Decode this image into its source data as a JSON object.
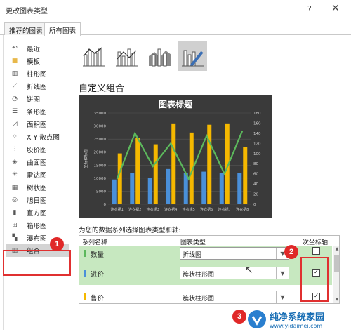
{
  "window": {
    "title": "更改图表类型",
    "help": "?",
    "close": "✕"
  },
  "tabs": [
    {
      "label": "推荐的图表"
    },
    {
      "label": "所有图表"
    }
  ],
  "sidebar": {
    "items": [
      {
        "label": "最近",
        "icon": "recent-icon",
        "glyph": "↶"
      },
      {
        "label": "模板",
        "icon": "folder-icon",
        "glyph": "■"
      },
      {
        "label": "柱形图",
        "icon": "column-chart-icon",
        "glyph": "▥"
      },
      {
        "label": "折线图",
        "icon": "line-chart-icon",
        "glyph": "⟋"
      },
      {
        "label": "饼图",
        "icon": "pie-chart-icon",
        "glyph": "◔"
      },
      {
        "label": "条形图",
        "icon": "bar-chart-icon",
        "glyph": "☰"
      },
      {
        "label": "面积图",
        "icon": "area-chart-icon",
        "glyph": "◿"
      },
      {
        "label": "X Y 散点图",
        "icon": "scatter-chart-icon",
        "glyph": "⁘"
      },
      {
        "label": "股价图",
        "icon": "stock-chart-icon",
        "glyph": "⫶"
      },
      {
        "label": "曲面图",
        "icon": "surface-chart-icon",
        "glyph": "◈"
      },
      {
        "label": "雷达图",
        "icon": "radar-chart-icon",
        "glyph": "✳"
      },
      {
        "label": "树状图",
        "icon": "treemap-chart-icon",
        "glyph": "▦"
      },
      {
        "label": "旭日图",
        "icon": "sunburst-chart-icon",
        "glyph": "◎"
      },
      {
        "label": "直方图",
        "icon": "histogram-chart-icon",
        "glyph": "▮"
      },
      {
        "label": "箱形图",
        "icon": "boxplot-chart-icon",
        "glyph": "⊞"
      },
      {
        "label": "瀑布图",
        "icon": "waterfall-chart-icon",
        "glyph": "▚"
      },
      {
        "label": "组合",
        "icon": "combo-chart-icon",
        "glyph": "▥"
      }
    ],
    "active_index": 16
  },
  "section_title": "自定义组合",
  "chart_data": {
    "type": "bar",
    "title": "图表标题",
    "categories": [
      "连衣裙1",
      "连衣裙2",
      "连衣裙3",
      "连衣裙4",
      "连衣裙5",
      "连衣裙6",
      "连衣裙7",
      "连衣裙8"
    ],
    "series": [
      {
        "kind": "bar",
        "axis": "left",
        "color": "#4a90d9",
        "values": [
          9500,
          12000,
          10000,
          13500,
          12000,
          12500,
          12000,
          12000
        ]
      },
      {
        "kind": "bar",
        "axis": "left",
        "color": "#f5b800",
        "values": [
          19500,
          25500,
          23000,
          31000,
          27500,
          30500,
          31000,
          22000
        ]
      },
      {
        "kind": "line",
        "axis": "right",
        "color": "#5cb85c",
        "values": [
          50,
          140,
          75,
          120,
          50,
          135,
          60,
          145
        ]
      }
    ],
    "ylim_left": [
      0,
      35000
    ],
    "yticks_left": [
      0,
      5000,
      10000,
      15000,
      20000,
      25000,
      30000,
      35000
    ],
    "ylim_right": [
      0,
      180
    ],
    "yticks_right": [
      0,
      20,
      40,
      60,
      80,
      100,
      120,
      140,
      160,
      180
    ],
    "ylabel": "坐标轴标题",
    "grid": true,
    "background": "#3a3a3a"
  },
  "series_prompt": "为您的数据系列选择图表类型和轴:",
  "table": {
    "headers": {
      "name": "系列名称",
      "type": "图表类型",
      "axis": "次坐标轴"
    },
    "rows": [
      {
        "name": "数量",
        "type": "折线图",
        "secondary": false,
        "color": "#5cb85c"
      },
      {
        "name": "进价",
        "type": "簇状柱形图",
        "secondary": true,
        "color": "#4a90d9"
      },
      {
        "name": "售价",
        "type": "簇状柱形图",
        "secondary": true,
        "color": "#f5b800"
      }
    ]
  },
  "badges": [
    "1",
    "2",
    "3"
  ],
  "watermark": {
    "name": "纯净系统家园",
    "url": "www.yidaimei.com"
  }
}
